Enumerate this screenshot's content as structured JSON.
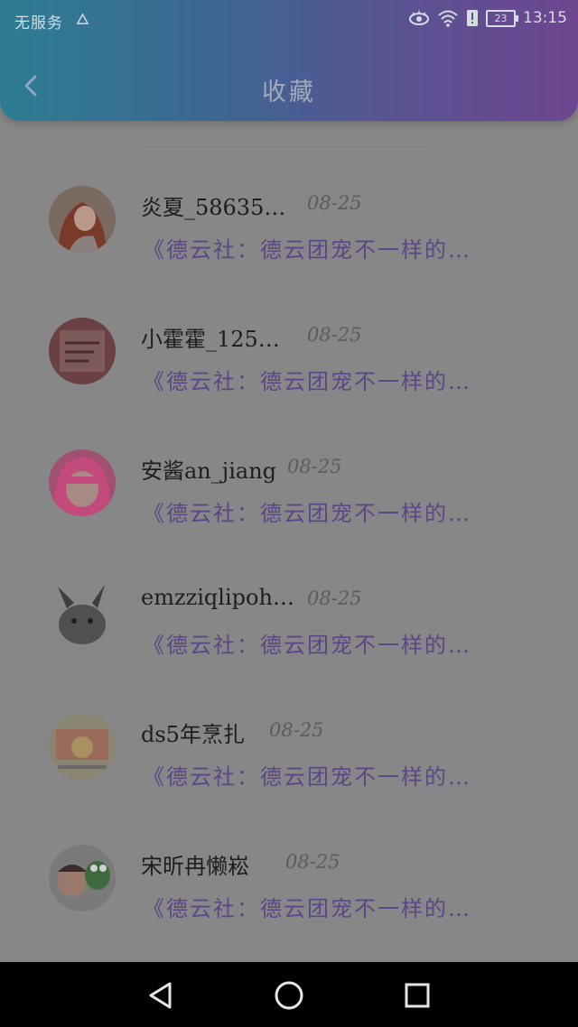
{
  "status_bar": {
    "carrier": "无服务",
    "battery": "23",
    "time": "13:15"
  },
  "header": {
    "title": "收藏"
  },
  "items": [
    {
      "name": "炎夏_58635…",
      "date": "08-25",
      "desc": "《德云社：德云团宠不一样的…"
    },
    {
      "name": "小霍霍_125…",
      "date": "08-25",
      "desc": "《德云社：德云团宠不一样的…"
    },
    {
      "name": "安酱an_jiang",
      "date": "08-25",
      "desc": "《德云社：德云团宠不一样的…"
    },
    {
      "name": "emzziqlipoh…",
      "date": "08-25",
      "desc": "《德云社：德云团宠不一样的…"
    },
    {
      "name": "ds5年烹扎",
      "date": "08-25",
      "desc": "《德云社：德云团宠不一样的…"
    },
    {
      "name": "宋昕冉懒崧",
      "date": "08-25",
      "desc": "《德云社：德云团宠不一样的…"
    }
  ],
  "colors": {
    "header_start": "#2d7d92",
    "header_end": "#6e4690",
    "desc_text": "#5c4688",
    "overlay_bg": "#878787"
  }
}
